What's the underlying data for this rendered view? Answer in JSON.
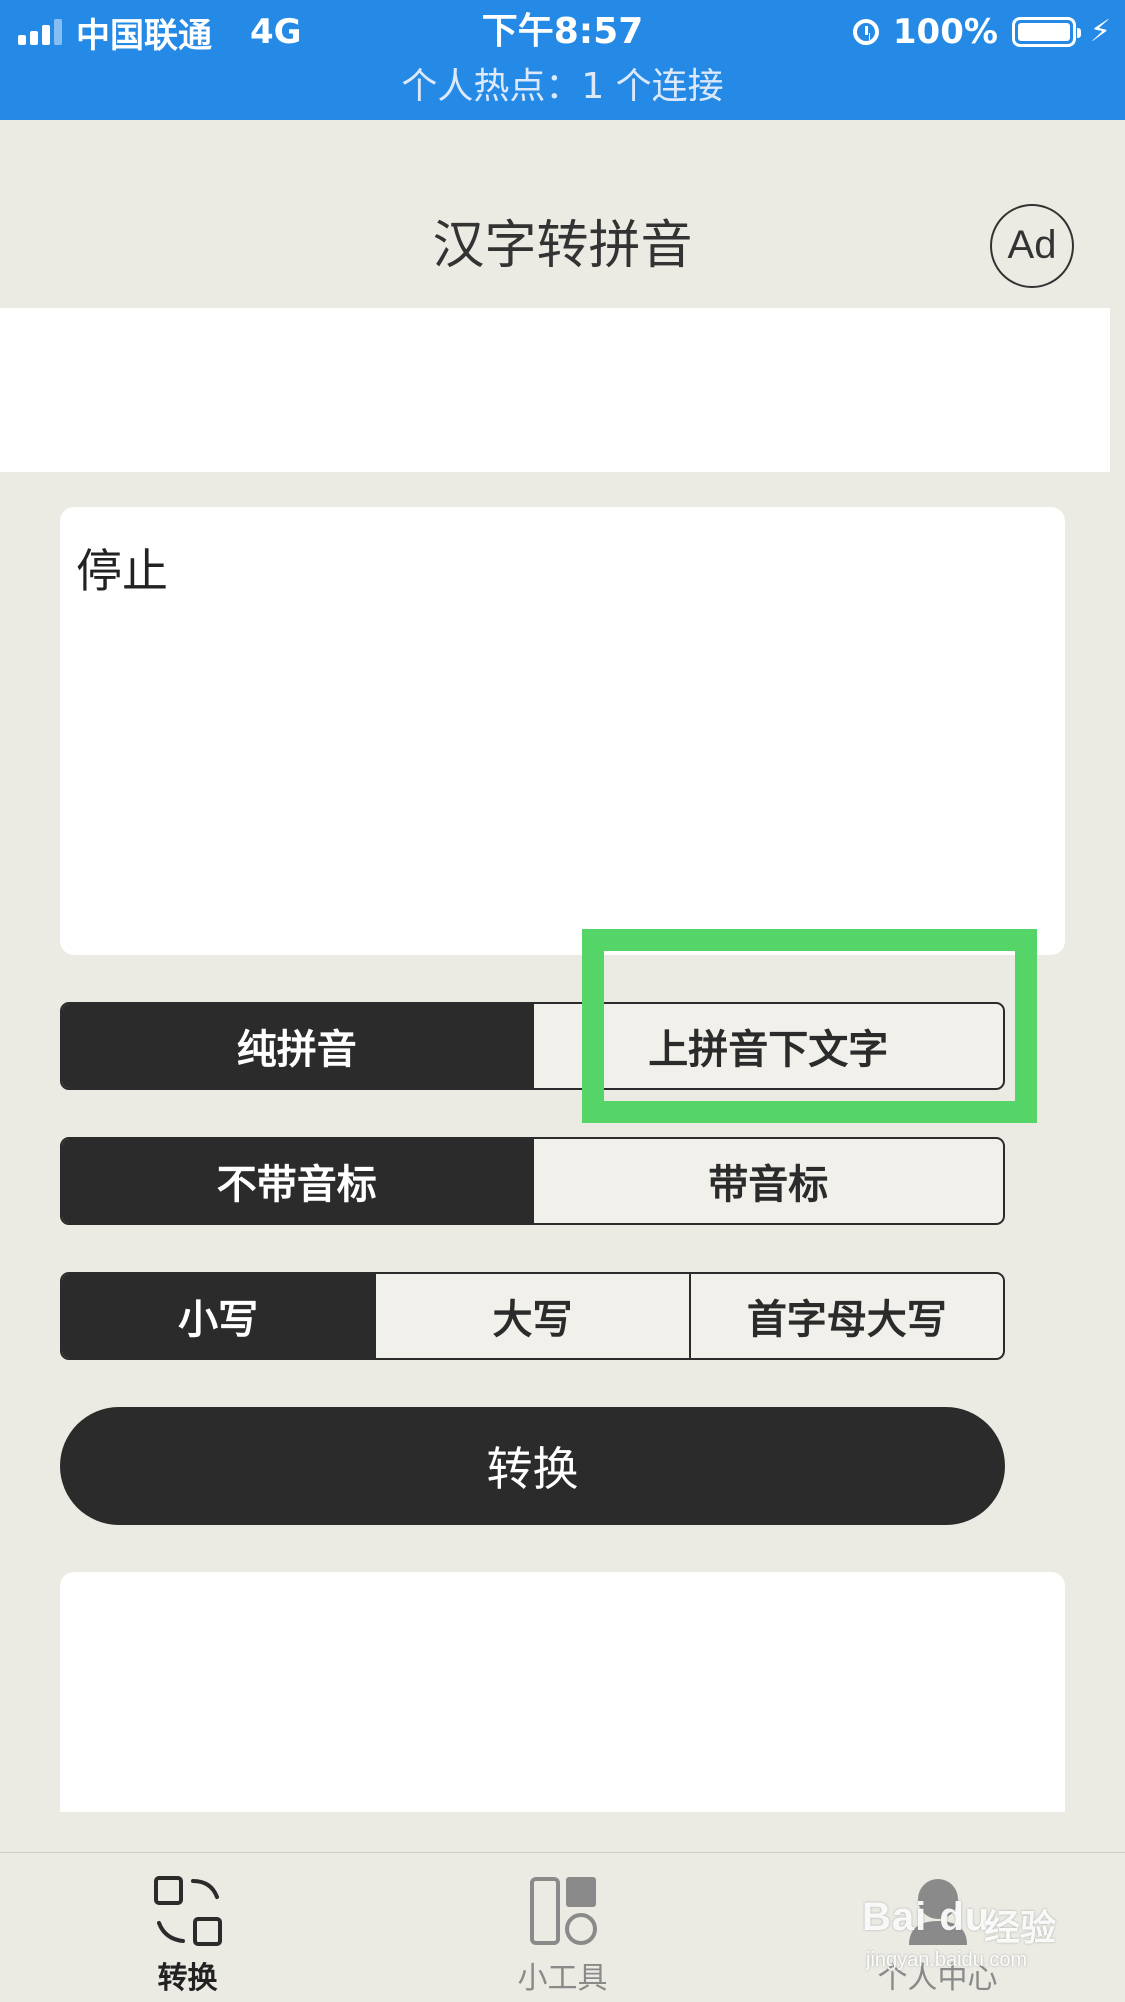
{
  "status_bar": {
    "carrier": "中国联通",
    "network": "4G",
    "time": "下午8:57",
    "battery": "100%",
    "hotspot": "个人热点：1 个连接"
  },
  "header": {
    "title": "汉字转拼音",
    "ad_label": "Ad"
  },
  "input": {
    "value": "停止"
  },
  "options": {
    "mode": {
      "items": [
        "纯拼音",
        "上拼音下文字"
      ],
      "selected": 0
    },
    "tone": {
      "items": [
        "不带音标",
        "带音标"
      ],
      "selected": 0
    },
    "case": {
      "items": [
        "小写",
        "大写",
        "首字母大写"
      ],
      "selected": 0
    }
  },
  "convert_button": {
    "label": "转换"
  },
  "output": {
    "value": ""
  },
  "tabbar": {
    "items": [
      {
        "label": "转换",
        "icon": "convert-icon",
        "active": true
      },
      {
        "label": "小工具",
        "icon": "tools-icon",
        "active": false
      },
      {
        "label": "个人中心",
        "icon": "profile-icon",
        "active": false
      }
    ]
  },
  "watermark": {
    "logo": "Bai du",
    "text": "经验",
    "url": "jingyan.baidu.com"
  },
  "colors": {
    "status_bar": "#2589e6",
    "background": "#ebeae3",
    "dark": "#2b2b2b",
    "highlight": "#55d467"
  }
}
